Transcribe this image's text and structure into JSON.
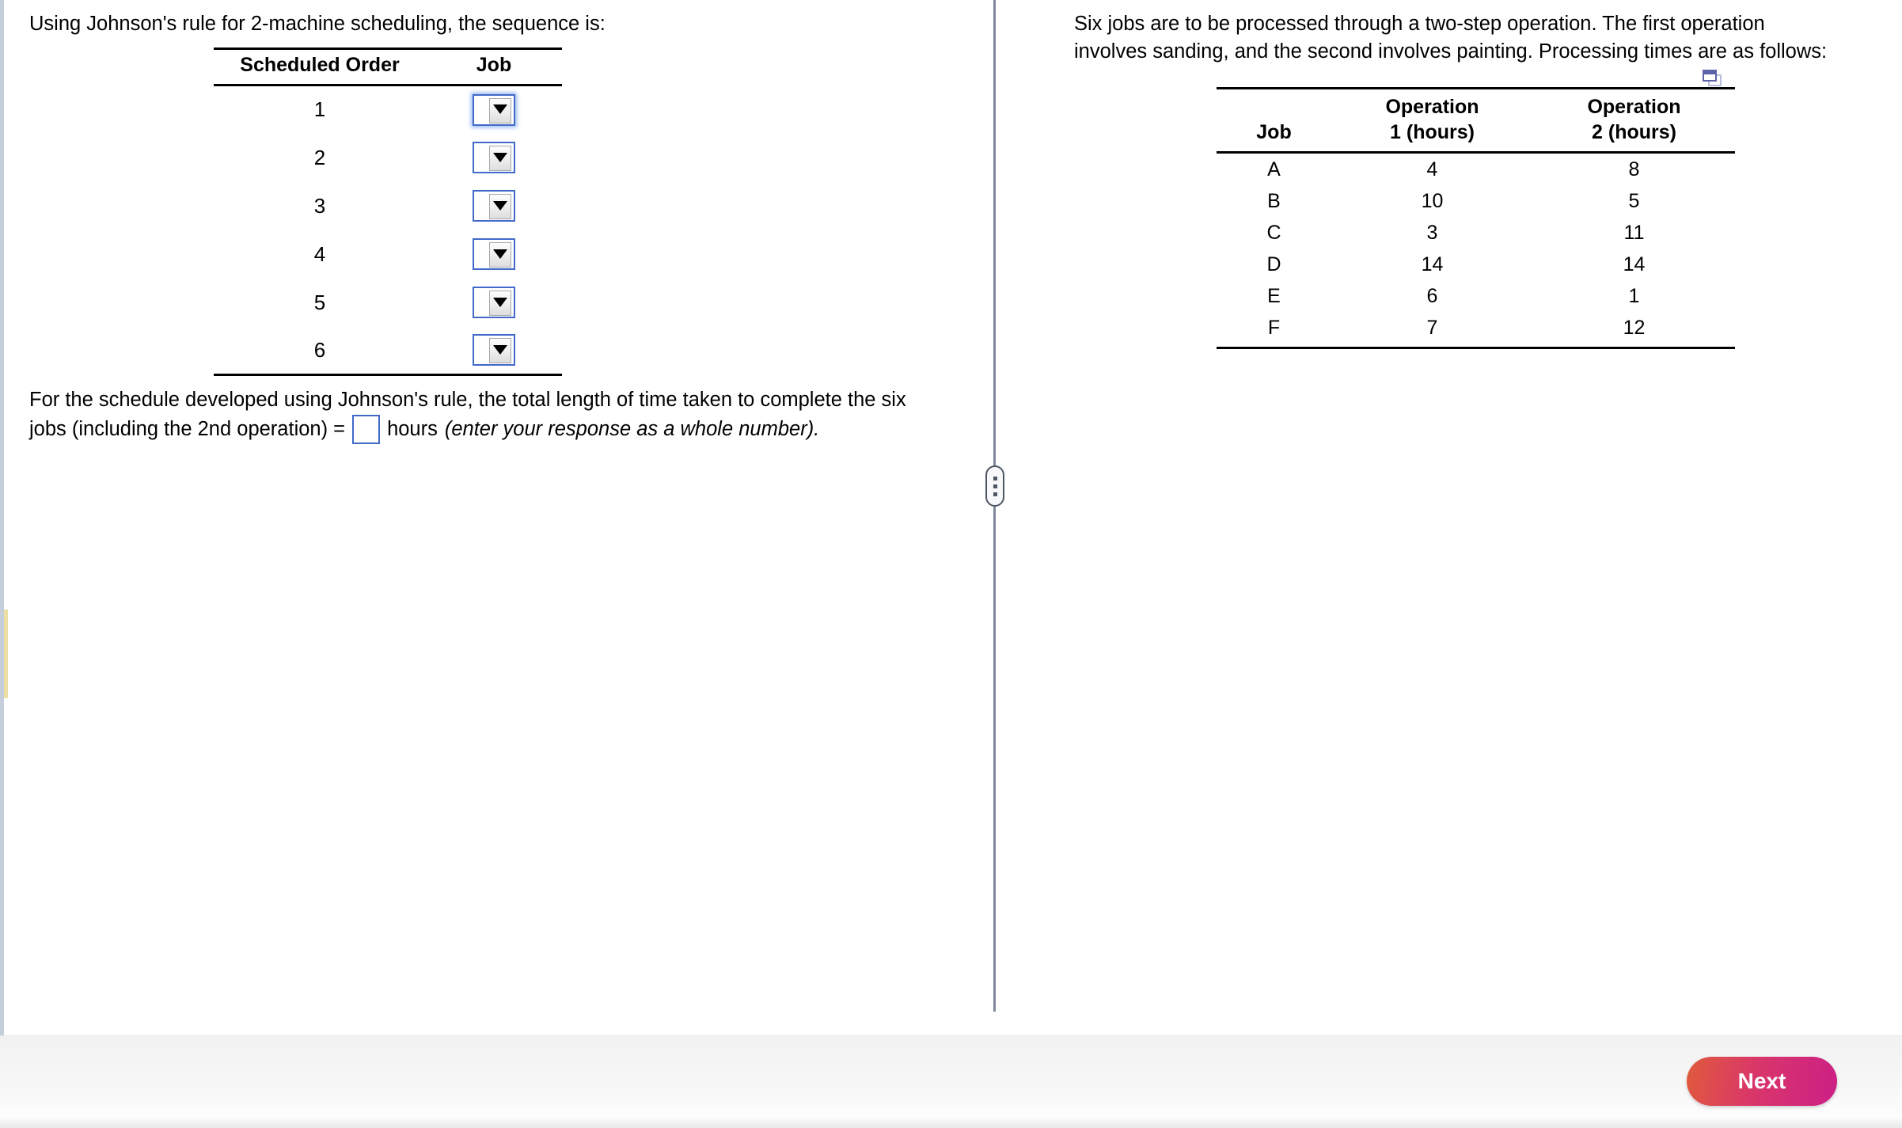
{
  "left_panel": {
    "prompt": "Using Johnson's rule for 2-machine scheduling, the sequence is:",
    "sequence_table": {
      "headers": {
        "order": "Scheduled Order",
        "job": "Job"
      },
      "rows": [
        {
          "order": "1",
          "job_value": "",
          "focused": true
        },
        {
          "order": "2",
          "job_value": "",
          "focused": false
        },
        {
          "order": "3",
          "job_value": "",
          "focused": false
        },
        {
          "order": "4",
          "job_value": "",
          "focused": false
        },
        {
          "order": "5",
          "job_value": "",
          "focused": false
        },
        {
          "order": "6",
          "job_value": "",
          "focused": false
        }
      ]
    },
    "answer": {
      "line1": "For the schedule developed using Johnson's rule, the total length of time taken to complete the six",
      "line2_before": "jobs (including the 2nd operation) =",
      "input_value": "",
      "line2_after": "hours",
      "line2_note": "(enter your response as a whole number)."
    }
  },
  "right_panel": {
    "prompt": "Six jobs are to be processed through a two-step operation.  The first operation\ninvolves sanding, and the second involves painting. Processing times are as follows:",
    "copy_icon": "copy-to-spreadsheet-icon",
    "times_table": {
      "headers": {
        "job": "Job",
        "op1": "Operation\n1 (hours)",
        "op2": "Operation\n2 (hours)"
      },
      "rows": [
        {
          "job": "A",
          "op1": "4",
          "op2": "8"
        },
        {
          "job": "B",
          "op1": "10",
          "op2": "5"
        },
        {
          "job": "C",
          "op1": "3",
          "op2": "11"
        },
        {
          "job": "D",
          "op1": "14",
          "op2": "14"
        },
        {
          "job": "E",
          "op1": "6",
          "op2": "1"
        },
        {
          "job": "F",
          "op1": "7",
          "op2": "12"
        }
      ]
    }
  },
  "footer": {
    "next_label": "Next"
  },
  "colors": {
    "input_border": "#4169c9",
    "splitter": "#7f8899",
    "gutter_marker": "#ecdfa4",
    "next_gradient_start": "#e05a3c",
    "next_gradient_end": "#cc1f86",
    "copy_icon": "#5c63a8"
  }
}
